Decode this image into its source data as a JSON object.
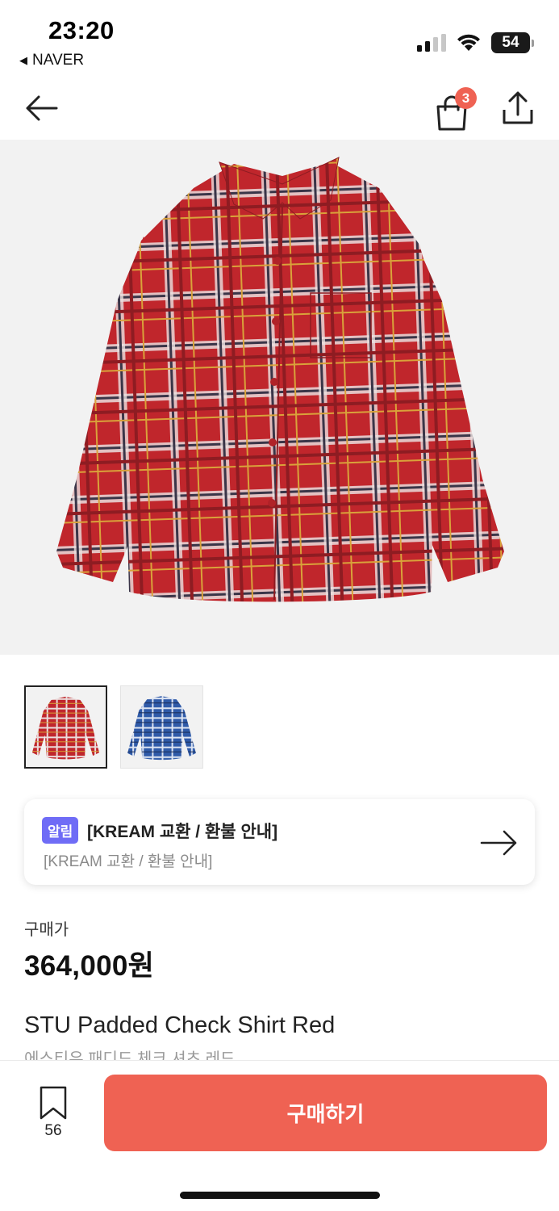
{
  "status_bar": {
    "time": "23:20",
    "back_app": "NAVER",
    "battery": "54"
  },
  "nav": {
    "cart_count": "3",
    "icons": [
      "arrow-left-icon",
      "shopping-bag-icon",
      "share-icon"
    ]
  },
  "product": {
    "images": [
      {
        "name": "red-check-shirt",
        "selected": true
      },
      {
        "name": "blue-check-shirt",
        "selected": false
      }
    ],
    "notice": {
      "tag": "알림",
      "title": "[KREAM 교환 / 환불 안내]",
      "subtitle": "[KREAM 교환 / 환불 안내]"
    },
    "price_label": "구매가",
    "price": "364,000원",
    "name": "STU Padded Check Shirt Red",
    "name_ko": "에스티유 패디드 체크 셔츠 레드"
  },
  "bottom_bar": {
    "bookmark_count": "56",
    "buy_label": "구매하기"
  },
  "colors": {
    "accent": "#ef6253",
    "notice_tag": "#6f6cf6",
    "shirt_red": "#c0262c",
    "shirt_blue": "#2f5aa8"
  }
}
